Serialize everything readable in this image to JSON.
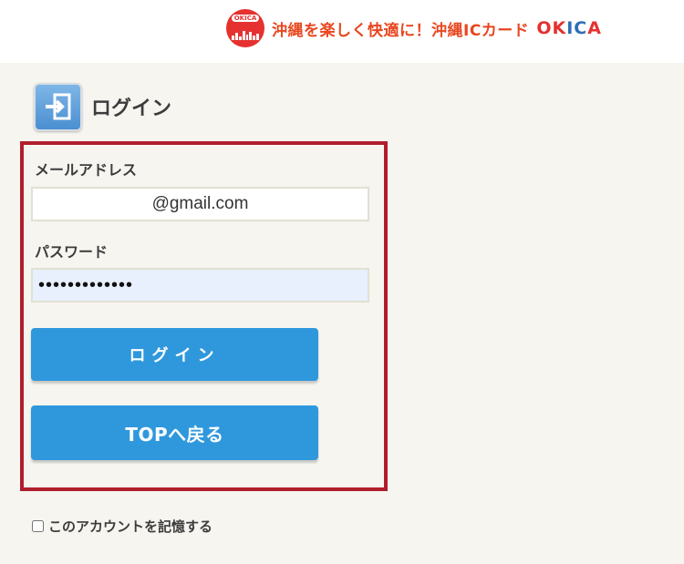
{
  "header": {
    "logo_text": "OKICA",
    "tagline": "沖縄を楽しく快適に！沖縄ICカード",
    "brand_part1": "OK",
    "brand_part2": "IC",
    "brand_part3": "A",
    "brand_color_red": "#e5312f",
    "brand_color_blue": "#2c6fb6"
  },
  "page": {
    "title": "ログイン",
    "icon": "login-door-icon"
  },
  "form": {
    "email_label": "メールアドレス",
    "email_value": "@gmail.com",
    "password_label": "パスワード",
    "password_value": "•••••••••••••",
    "login_button": "ログイン",
    "top_button": "TOPへ戻る",
    "border_color": "#b01e2b",
    "button_color": "#2f98dd"
  },
  "remember": {
    "label": "このアカウントを記憶する",
    "checked": false
  }
}
